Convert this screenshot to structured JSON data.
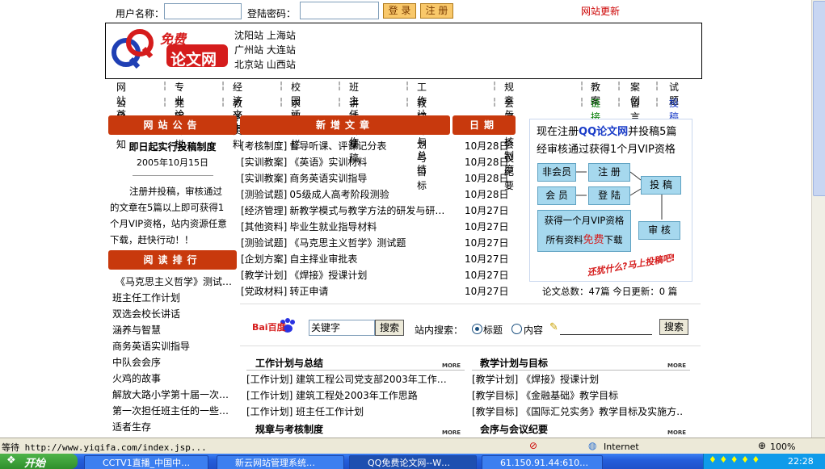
{
  "login": {
    "username_label": "用户名称：",
    "password_label": "登陆密码：",
    "login_button": "登 录",
    "register_button": "注 册",
    "site_update": "网站更新"
  },
  "header": {
    "logo_top": "免费",
    "logo_main": "论文网",
    "branches": [
      "沈阳站 上海站",
      "广州站 大连站",
      "北京站 山西站"
    ]
  },
  "nav": {
    "row1": [
      "网站首页",
      "专业论文",
      "经济文书",
      "校园活动",
      "班主任工作",
      "工作计划与总结",
      "规章与考核制度",
      "教案",
      "案例",
      "试题"
    ],
    "row2": [
      "公函通知",
      "党团专栏",
      "教学资料",
      "求职专栏",
      "讲话讲稿稿",
      "教学计划与目标",
      "会序与会议纪要",
      "链接",
      "留言",
      "投稿"
    ]
  },
  "announcement": {
    "header": "网站公告",
    "title": "即日起实行投稿制度",
    "date": "2005年10月15日",
    "body_lines": [
      "注册并投稿，审核通过",
      "的文章在5篇以上即可获得1",
      "个月VIP资格，站内资源任意",
      "下载，赶快行动！！"
    ]
  },
  "ranking": {
    "header": "阅读排行",
    "items": [
      "《马克思主义哲学》测试…",
      "班主任工作计划",
      "双选会校长讲话",
      "涵养与智慧",
      "商务英语实训指导",
      "中队会会序",
      "火鸡的故事",
      "解放大路小学第十届一次…",
      "第一次担任班主任的一些…",
      "适者生存"
    ]
  },
  "new_articles": {
    "header": "新增文章",
    "date_header": "日期",
    "items": [
      {
        "cat": "[考核制度]",
        "title": "督导听课、评课记分表",
        "date": "10月28日"
      },
      {
        "cat": "[实训教案]",
        "title": "《英语》实训材料",
        "date": "10月28日"
      },
      {
        "cat": "[实训教案]",
        "title": "商务英语实训指导",
        "date": "10月28日"
      },
      {
        "cat": "[测验试题]",
        "title": "05级成人高考阶段测验",
        "date": "10月28日"
      },
      {
        "cat": "[经济管理]",
        "title": "新教学模式与教学方法的研发与研…",
        "date": "10月27日"
      },
      {
        "cat": "[其他资料]",
        "title": "毕业生就业指导材料",
        "date": "10月27日"
      },
      {
        "cat": "[测验试题]",
        "title": "《马克思主义哲学》测试题",
        "date": "10月27日"
      },
      {
        "cat": "[企划方案]",
        "title": "自主择业审批表",
        "date": "10月27日"
      },
      {
        "cat": "[教学计划]",
        "title": "《焊接》授课计划",
        "date": "10月27日"
      },
      {
        "cat": "[党政材料]",
        "title": "转正申请",
        "date": "10月27日"
      }
    ]
  },
  "promo": {
    "line1_pre": "现在注册",
    "line1_brand": "QQ论文网",
    "line1_post": "并投稿5篇",
    "line2": "经审核通过获得1个月VIP资格",
    "non_member": "非会员",
    "register": "注 册",
    "member": "会 员",
    "login": "登 陆",
    "submit": "投 稿",
    "vip_line1": "获得一个月VIP资格",
    "vip_line2_pre": "所有资料",
    "vip_free": "免费",
    "vip_line2_post": "下载",
    "review": "审 核",
    "slogan": "还犹什么?马上投稿吧!",
    "stats": "论文总数：47篇 今日更新：0 篇"
  },
  "search": {
    "baidu_logo": "Bai百度",
    "keyword_value": "关键字",
    "search_button": "搜索",
    "site_search_label": "站内搜索：",
    "opt_title": "标题",
    "opt_content": "内容",
    "site_search_button": "搜索"
  },
  "sections": {
    "work_plan": {
      "title": "工作计划与总结",
      "more": "MORE",
      "items": [
        "[工作计划] 建筑工程公司党支部2003年工作…",
        "[工作计划] 建筑工程处2003年工作思路",
        "[工作计划] 班主任工作计划"
      ]
    },
    "teach_plan": {
      "title": "教学计划与目标",
      "more": "MORE",
      "items": [
        "[教学计划] 《焊接》授课计划",
        "[教学目标] 《金融基础》教学目标",
        "[教学目标] 《国际汇兑实务》教学目标及实施方…"
      ]
    },
    "rules": {
      "title": "规章与考核制度",
      "more": "MORE"
    },
    "meeting": {
      "title": "会序与会议纪要",
      "more": "MORE"
    }
  },
  "statusbar": {
    "text": "等待 http://www.yiqifa.com/index.jsp...",
    "zone": "Internet",
    "zoom": "100%"
  },
  "taskbar": {
    "start": "开始",
    "tasks": [
      "CCTV1直播_中国中…",
      "新云网站管理系统…",
      "QQ免费论文网--W…",
      "61.150.91.44:610…"
    ],
    "clock": "22:28"
  },
  "colors": {
    "header_red": "#c8390d",
    "link_blue": "#1a3cc8",
    "green_link": "#007a00"
  }
}
